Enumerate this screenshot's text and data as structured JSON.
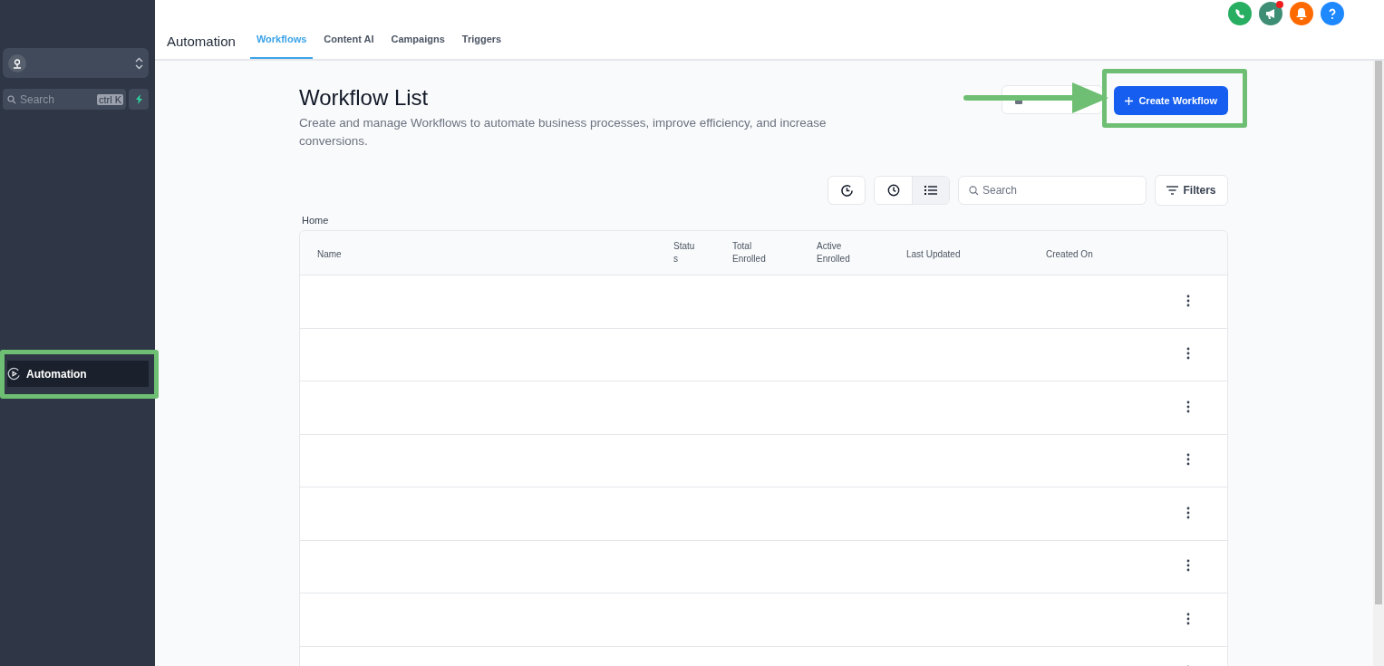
{
  "sidebar": {
    "search": {
      "placeholder": "Search",
      "shortcut": "ctrl K"
    },
    "items": [
      {
        "label": "Automation",
        "selected": true
      }
    ]
  },
  "header": {
    "title": "Automation",
    "tabs": [
      {
        "label": "Workflows",
        "selected": true
      },
      {
        "label": "Content AI",
        "selected": false
      },
      {
        "label": "Campaigns",
        "selected": false
      },
      {
        "label": "Triggers",
        "selected": false
      }
    ],
    "notification_badge": true
  },
  "page": {
    "title": "Workflow List",
    "description": "Create and manage Workflows to automate business processes, improve efficiency, and increase conversions.",
    "create_button": "Create Workflow"
  },
  "toolbar": {
    "view_modes": [
      {
        "selected": false
      },
      {
        "selected": true
      }
    ],
    "search": {
      "placeholder": "Search"
    },
    "filters_button": "Filters"
  },
  "breadcrumb": "Home",
  "table": {
    "columns": [
      "Name",
      "Status",
      "Total Enrolled",
      "Active Enrolled",
      "Last Updated",
      "Created On"
    ],
    "rows": [
      {
        "kind": "blank"
      },
      {
        "kind": "blank"
      },
      {
        "kind": "blank"
      },
      {
        "kind": "blank"
      },
      {
        "kind": "blank"
      },
      {
        "kind": "blank"
      },
      {
        "kind": "blank"
      },
      {
        "kind": "blank"
      }
    ]
  }
}
